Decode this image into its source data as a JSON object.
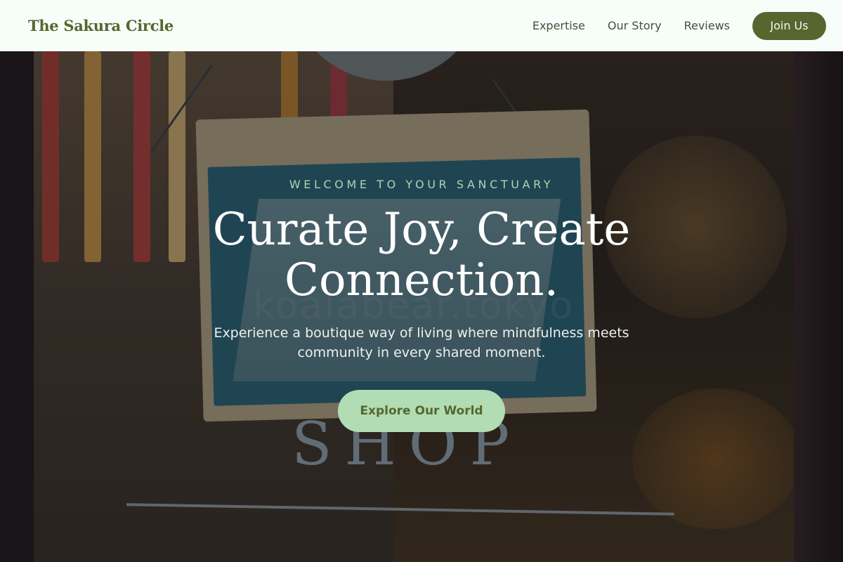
{
  "header": {
    "brand": "The Sakura Circle",
    "nav": [
      "Expertise",
      "Our Story",
      "Reviews"
    ],
    "join_label": "Join Us"
  },
  "hero": {
    "eyebrow": "WELCOME TO YOUR SANCTUARY",
    "headline": "Curate Joy, Create Connection.",
    "subtitle": "Experience a boutique way of living where mindfulness meets community in every shared moment.",
    "cta_label": "Explore Our World",
    "photo_text": {
      "shop": "SHOP",
      "watermark": "koalabear.tokyo"
    }
  },
  "colors": {
    "header_bg": "#f7fdf8",
    "brand": "#55672f",
    "cta_bg": "#b2dcb3",
    "eyebrow": "#a9d6b3"
  }
}
